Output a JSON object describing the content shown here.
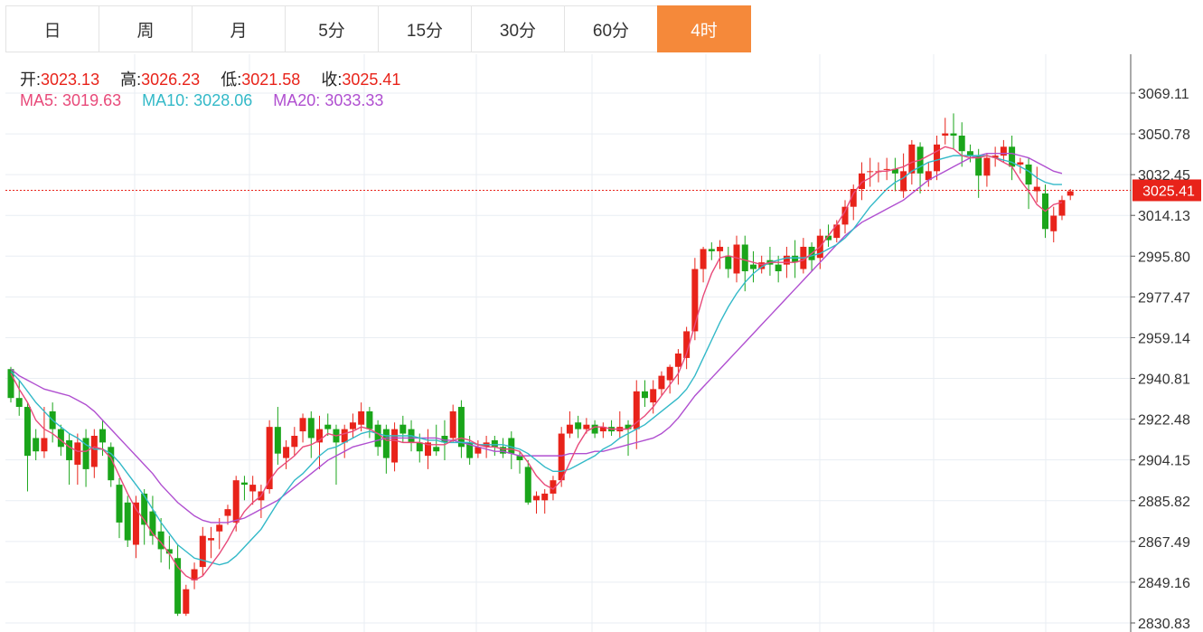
{
  "tabs": [
    {
      "label": "日",
      "active": false
    },
    {
      "label": "周",
      "active": false
    },
    {
      "label": "月",
      "active": false
    },
    {
      "label": "5分",
      "active": false
    },
    {
      "label": "15分",
      "active": false
    },
    {
      "label": "30分",
      "active": false
    },
    {
      "label": "60分",
      "active": false
    },
    {
      "label": "4时",
      "active": true
    }
  ],
  "ohlc": {
    "open_label": "开:",
    "open": "3023.13",
    "high_label": "高:",
    "high": "3026.23",
    "low_label": "低:",
    "low": "3021.58",
    "close_label": "收:",
    "close": "3025.41"
  },
  "ma": {
    "ma5_label": "MA5:",
    "ma5": "3019.63",
    "ma10_label": "MA10:",
    "ma10": "3028.06",
    "ma20_label": "MA20:",
    "ma20": "3033.33"
  },
  "colors": {
    "up": "#e8231a",
    "down": "#1aa51a",
    "ma5": "#e84a7a",
    "ma10": "#33b9c8",
    "ma20": "#b04fd0",
    "accent": "#f5893a"
  },
  "chart_data": {
    "type": "candlestick",
    "y_ticks": [
      "3069.11",
      "3050.78",
      "3032.45",
      "3014.13",
      "2995.80",
      "2977.47",
      "2959.14",
      "2940.81",
      "2922.48",
      "2904.15",
      "2885.82",
      "2867.49",
      "2849.16",
      "2830.83"
    ],
    "ylim": [
      2830.83,
      3080
    ],
    "last_price": "3025.41",
    "grid": true,
    "candles": [
      [
        2945,
        2932,
        2946,
        2930
      ],
      [
        2932,
        2928,
        2940,
        2924
      ],
      [
        2928,
        2906,
        2930,
        2890
      ],
      [
        2914,
        2908,
        2918,
        2904
      ],
      [
        2908,
        2914,
        2928,
        2905
      ],
      [
        2926,
        2918,
        2930,
        2912
      ],
      [
        2918,
        2910,
        2920,
        2906
      ],
      [
        2913,
        2904,
        2916,
        2893
      ],
      [
        2902,
        2912,
        2916,
        2893
      ],
      [
        2914,
        2900,
        2918,
        2892
      ],
      [
        2901,
        2915,
        2918,
        2896
      ],
      [
        2918,
        2912,
        2922,
        2906
      ],
      [
        2910,
        2895,
        2912,
        2892
      ],
      [
        2893,
        2876,
        2896,
        2869
      ],
      [
        2885,
        2868,
        2888,
        2865
      ],
      [
        2866,
        2885,
        2888,
        2860
      ],
      [
        2889,
        2875,
        2891,
        2866
      ],
      [
        2881,
        2870,
        2888,
        2866
      ],
      [
        2872,
        2864,
        2878,
        2858
      ],
      [
        2864,
        2862,
        2870,
        2855
      ],
      [
        2860,
        2835,
        2866,
        2834
      ],
      [
        2835,
        2846,
        2848,
        2834
      ],
      [
        2850,
        2855,
        2858,
        2846
      ],
      [
        2856,
        2870,
        2874,
        2852
      ],
      [
        2868,
        2869,
        2874,
        2860
      ],
      [
        2872,
        2875,
        2878,
        2864
      ],
      [
        2879,
        2882,
        2884,
        2875
      ],
      [
        2876,
        2895,
        2897,
        2872
      ],
      [
        2894,
        2893,
        2897,
        2886
      ],
      [
        2890,
        2893,
        2897,
        2884
      ],
      [
        2886,
        2890,
        2893,
        2878
      ],
      [
        2891,
        2919,
        2922,
        2889
      ],
      [
        2919,
        2907,
        2928,
        2902
      ],
      [
        2905,
        2910,
        2913,
        2900
      ],
      [
        2910,
        2915,
        2919,
        2906
      ],
      [
        2917,
        2923,
        2925,
        2912
      ],
      [
        2923,
        2914,
        2926,
        2905
      ],
      [
        2912,
        2918,
        2924,
        2900
      ],
      [
        2920,
        2918,
        2925,
        2915
      ],
      [
        2918,
        2912,
        2920,
        2893
      ],
      [
        2912,
        2918,
        2920,
        2905
      ],
      [
        2918,
        2921,
        2925,
        2914
      ],
      [
        2920,
        2926,
        2930,
        2917
      ],
      [
        2926,
        2918,
        2928,
        2914
      ],
      [
        2920,
        2910,
        2922,
        2906
      ],
      [
        2918,
        2905,
        2920,
        2898
      ],
      [
        2903,
        2918,
        2921,
        2899
      ],
      [
        2920,
        2916,
        2924,
        2912
      ],
      [
        2918,
        2912,
        2922,
        2908
      ],
      [
        2912,
        2908,
        2916,
        2903
      ],
      [
        2906,
        2912,
        2918,
        2900
      ],
      [
        2910,
        2908,
        2920,
        2906
      ],
      [
        2915,
        2912,
        2922,
        2904
      ],
      [
        2914,
        2926,
        2929,
        2912
      ],
      [
        2928,
        2910,
        2931,
        2905
      ],
      [
        2912,
        2905,
        2915,
        2902
      ],
      [
        2907,
        2910,
        2913,
        2905
      ],
      [
        2910,
        2912,
        2915,
        2905
      ],
      [
        2913,
        2910,
        2915,
        2906
      ],
      [
        2910,
        2907,
        2914,
        2905
      ],
      [
        2914,
        2907,
        2917,
        2900
      ],
      [
        2906,
        2904,
        2908,
        2898
      ],
      [
        2901,
        2885,
        2904,
        2884
      ],
      [
        2886,
        2888,
        2890,
        2880
      ],
      [
        2886,
        2889,
        2891,
        2880
      ],
      [
        2889,
        2895,
        2897,
        2886
      ],
      [
        2895,
        2916,
        2919,
        2892
      ],
      [
        2916,
        2920,
        2926,
        2914
      ],
      [
        2921,
        2918,
        2924,
        2914
      ],
      [
        2918,
        2920,
        2923,
        2916
      ],
      [
        2920,
        2916,
        2922,
        2914
      ],
      [
        2917,
        2919,
        2921,
        2914
      ],
      [
        2919,
        2917,
        2922,
        2915
      ],
      [
        2917,
        2919,
        2926,
        2914
      ],
      [
        2920,
        2918,
        2922,
        2906
      ],
      [
        2918,
        2935,
        2940,
        2909
      ],
      [
        2935,
        2932,
        2940,
        2928
      ],
      [
        2930,
        2936,
        2940,
        2925
      ],
      [
        2936,
        2942,
        2944,
        2933
      ],
      [
        2940,
        2946,
        2947,
        2934
      ],
      [
        2946,
        2952,
        2954,
        2938
      ],
      [
        2950,
        2962,
        2964,
        2945
      ],
      [
        2962,
        2990,
        2995,
        2958
      ],
      [
        2990,
        2999,
        3000,
        2984
      ],
      [
        2999,
        2998,
        3002,
        2994
      ],
      [
        2998,
        3000,
        3003,
        2990
      ],
      [
        2996,
        2990,
        3000,
        2986
      ],
      [
        2988,
        3001,
        3005,
        2984
      ],
      [
        3001,
        2989,
        3005,
        2980
      ],
      [
        2992,
        2990,
        2998,
        2984
      ],
      [
        2990,
        2993,
        2996,
        2988
      ],
      [
        2994,
        2992,
        3000,
        2987
      ],
      [
        2992,
        2989,
        2996,
        2984
      ],
      [
        2992,
        2996,
        3000,
        2986
      ],
      [
        2996,
        2993,
        3003,
        2986
      ],
      [
        2990,
        3000,
        3004,
        2988
      ],
      [
        3000,
        2994,
        3002,
        2989
      ],
      [
        2995,
        3005,
        3008,
        2990
      ],
      [
        3005,
        3003,
        3010,
        3000
      ],
      [
        3004,
        3010,
        3012,
        3002
      ],
      [
        3010,
        3018,
        3021,
        3006
      ],
      [
        3018,
        3026,
        3028,
        3012
      ],
      [
        3026,
        3033,
        3038,
        3021
      ],
      [
        3034,
        3034,
        3040,
        3027
      ],
      [
        3034,
        3034,
        3038,
        3029
      ],
      [
        3035,
        3035,
        3040,
        3030
      ],
      [
        3035,
        3033,
        3040,
        3025
      ],
      [
        3025,
        3034,
        3042,
        3022
      ],
      [
        3033,
        3046,
        3048,
        3028
      ],
      [
        3045,
        3033,
        3047,
        3024
      ],
      [
        3030,
        3034,
        3038,
        3027
      ],
      [
        3034,
        3046,
        3050,
        3030
      ],
      [
        3050,
        3051,
        3058,
        3046
      ],
      [
        3051,
        3050,
        3060,
        3044
      ],
      [
        3050,
        3043,
        3056,
        3036
      ],
      [
        3043,
        3041,
        3046,
        3038
      ],
      [
        3041,
        3032,
        3044,
        3022
      ],
      [
        3032,
        3040,
        3042,
        3027
      ],
      [
        3040,
        3041,
        3045,
        3036
      ],
      [
        3041,
        3045,
        3048,
        3038
      ],
      [
        3045,
        3036,
        3050,
        3030
      ],
      [
        3037,
        3038,
        3040,
        3033
      ],
      [
        3037,
        3028,
        3040,
        3017
      ],
      [
        3025,
        3027,
        3036,
        3020
      ],
      [
        3024,
        3008,
        3028,
        3004
      ],
      [
        3007,
        3014,
        3018,
        3002
      ],
      [
        3014,
        3021,
        3023,
        3012
      ],
      [
        3023,
        3025,
        3026,
        3021
      ]
    ],
    "ma5": [
      2943,
      2936,
      2930,
      2922,
      2918,
      2916,
      2913,
      2910,
      2908,
      2908,
      2910,
      2909,
      2905,
      2897,
      2889,
      2882,
      2877,
      2871,
      2867,
      2862,
      2856,
      2852,
      2850,
      2852,
      2857,
      2862,
      2868,
      2875,
      2881,
      2885,
      2888,
      2895,
      2900,
      2903,
      2906,
      2910,
      2911,
      2913,
      2916,
      2915,
      2916,
      2917,
      2919,
      2918,
      2916,
      2913,
      2913,
      2912,
      2912,
      2912,
      2911,
      2911,
      2911,
      2913,
      2914,
      2913,
      2911,
      2910,
      2910,
      2909,
      2909,
      2908,
      2903,
      2897,
      2893,
      2891,
      2895,
      2903,
      2911,
      2917,
      2919,
      2919,
      2918,
      2918,
      2918,
      2921,
      2924,
      2928,
      2933,
      2938,
      2943,
      2952,
      2965,
      2978,
      2988,
      2995,
      2996,
      2995,
      2994,
      2993,
      2992,
      2993,
      2993,
      2993,
      2993,
      2994,
      2997,
      3000,
      3005,
      3010,
      3016,
      3024,
      3029,
      3031,
      3034,
      3034,
      3035,
      3036,
      3038,
      3039,
      3041,
      3043,
      3045,
      3044,
      3041,
      3040,
      3040,
      3041,
      3040,
      3038,
      3036,
      3030,
      3025,
      3019,
      3016,
      3019,
      3020
    ],
    "ma10": [
      2944,
      2940,
      2935,
      2930,
      2926,
      2922,
      2919,
      2916,
      2914,
      2911,
      2909,
      2909,
      2907,
      2903,
      2898,
      2893,
      2888,
      2882,
      2876,
      2871,
      2866,
      2863,
      2860,
      2859,
      2858,
      2857,
      2858,
      2861,
      2865,
      2869,
      2873,
      2879,
      2885,
      2890,
      2895,
      2898,
      2902,
      2906,
      2909,
      2910,
      2912,
      2914,
      2916,
      2917,
      2916,
      2915,
      2915,
      2915,
      2915,
      2914,
      2913,
      2913,
      2912,
      2912,
      2912,
      2912,
      2911,
      2911,
      2911,
      2911,
      2910,
      2909,
      2907,
      2904,
      2901,
      2899,
      2899,
      2900,
      2902,
      2904,
      2906,
      2909,
      2911,
      2914,
      2916,
      2918,
      2920,
      2923,
      2926,
      2929,
      2932,
      2936,
      2942,
      2950,
      2958,
      2966,
      2973,
      2979,
      2984,
      2988,
      2991,
      2993,
      2994,
      2995,
      2995,
      2995,
      2996,
      2997,
      2999,
      3001,
      3004,
      3008,
      3013,
      3018,
      3022,
      3026,
      3029,
      3031,
      3034,
      3036,
      3038,
      3039,
      3040,
      3041,
      3041,
      3041,
      3041,
      3041,
      3040,
      3039,
      3038,
      3036,
      3034,
      3031,
      3029,
      3028,
      3028
    ],
    "ma20": [
      2945,
      2942,
      2940,
      2938,
      2936,
      2935,
      2934,
      2933,
      2931,
      2929,
      2926,
      2922,
      2918,
      2914,
      2910,
      2906,
      2902,
      2898,
      2893,
      2889,
      2885,
      2882,
      2879,
      2877,
      2876,
      2876,
      2876,
      2877,
      2878,
      2880,
      2882,
      2884,
      2886,
      2889,
      2892,
      2895,
      2898,
      2901,
      2904,
      2906,
      2908,
      2910,
      2911,
      2912,
      2913,
      2914,
      2914,
      2914,
      2914,
      2914,
      2914,
      2914,
      2913,
      2913,
      2912,
      2911,
      2910,
      2909,
      2908,
      2908,
      2907,
      2906,
      2906,
      2906,
      2906,
      2906,
      2906,
      2907,
      2907,
      2907,
      2908,
      2908,
      2909,
      2910,
      2911,
      2912,
      2913,
      2914,
      2916,
      2919,
      2923,
      2928,
      2933,
      2937,
      2941,
      2945,
      2949,
      2953,
      2957,
      2961,
      2965,
      2969,
      2973,
      2977,
      2981,
      2985,
      2989,
      2993,
      2997,
      3001,
      3005,
      3008,
      3011,
      3013,
      3015,
      3017,
      3019,
      3021,
      3024,
      3027,
      3030,
      3032,
      3034,
      3036,
      3038,
      3040,
      3041,
      3042,
      3042,
      3042,
      3042,
      3041,
      3040,
      3038,
      3036,
      3034,
      3033
    ]
  }
}
